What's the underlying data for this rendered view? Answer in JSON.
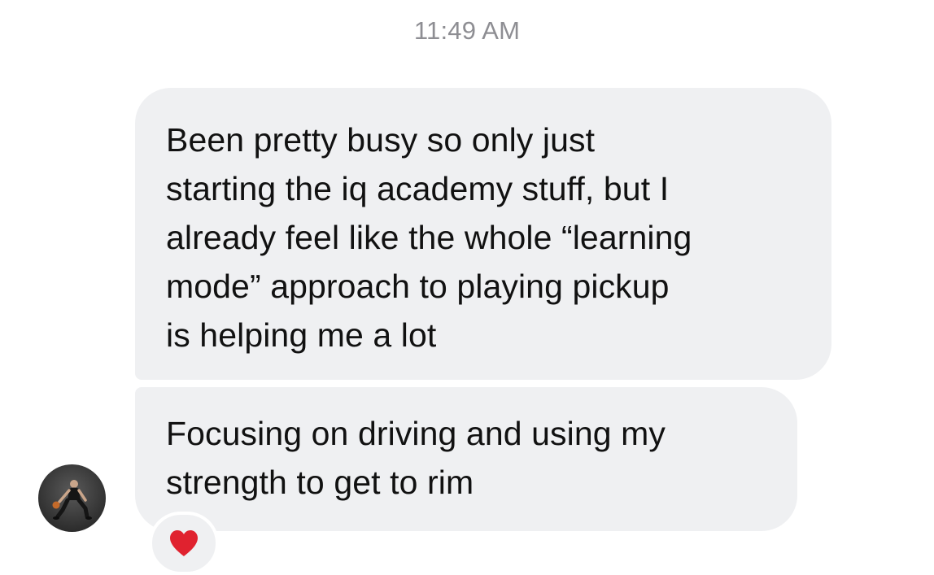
{
  "timestamp": "11:49 AM",
  "messages": [
    {
      "lines": [
        "Been pretty busy so only just",
        "starting the iq academy stuff, but I",
        "already feel like the whole “learning",
        "mode” approach to playing pickup",
        "is helping me a lot"
      ]
    },
    {
      "lines": [
        "Focusing on driving and using my",
        "strength to get to rim"
      ]
    }
  ],
  "reaction": {
    "icon": "heart-icon",
    "color": "#e0222f"
  },
  "colors": {
    "bubble": "#eff0f2",
    "timestamp": "#8e8e93",
    "text": "#111111"
  }
}
